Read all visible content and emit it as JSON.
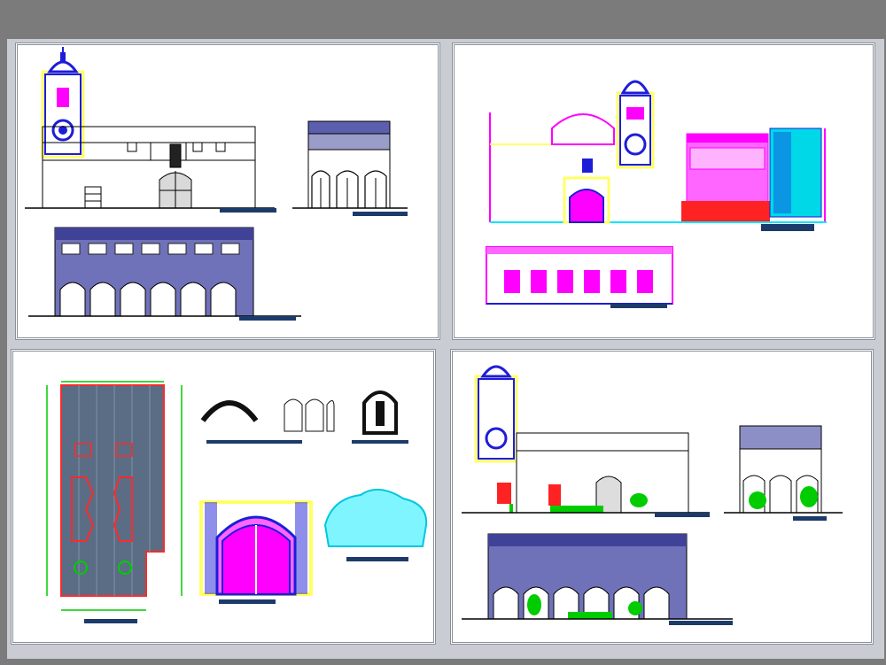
{
  "drawing": {
    "background_color": "#7b7b7b",
    "sheet_color": "#c9cdd3",
    "frame_color": "#8a8f99",
    "line_color": "#000000",
    "panels": [
      {
        "name": "elevations-monochrome",
        "views": [
          "bell-tower-street-elevation",
          "side-elevation-arcade",
          "arcade-front-elevation"
        ]
      },
      {
        "name": "elevations-color",
        "views": [
          "church-and-tower-elevation",
          "arcade-longitudinal-elevation"
        ]
      },
      {
        "name": "details",
        "views": [
          "floor-plan",
          "arch-detail",
          "window-detail",
          "niche-sculpture-detail",
          "portal-detail",
          "tree-canopy-block"
        ]
      },
      {
        "name": "elevations-vegetated",
        "views": [
          "tower-street-elevation-with-trees",
          "side-elevation-with-trees",
          "arcade-elevation-with-trees"
        ]
      }
    ],
    "colors": {
      "blue": "#1d1dd8",
      "magenta": "#ff00ff",
      "yellow": "#ffff66",
      "red": "#ff0000",
      "green": "#00cc00",
      "cyan": "#00e5ff",
      "plan_fill": "#5a6d85",
      "hatch": "#4a4aa8"
    }
  }
}
